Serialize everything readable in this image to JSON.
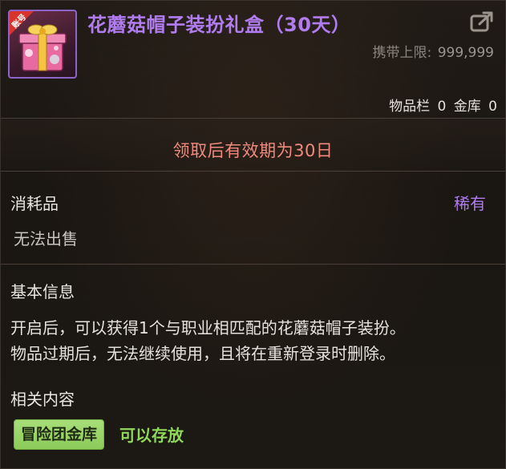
{
  "item": {
    "name": "花蘑菇帽子装扮礼盒（30天）",
    "icon": "gift-box-icon",
    "icon_badge": "账号",
    "carry_limit_label": "携带上限:",
    "carry_limit_value": "999,999",
    "inventory_label": "物品栏",
    "inventory_count": "0",
    "vault_label": "金库",
    "vault_count": "0"
  },
  "notice": "领取后有效期为30日",
  "category": "消耗品",
  "rarity": "稀有",
  "sell_status": "无法出售",
  "basic_info": {
    "title": "基本信息",
    "lines": [
      "开启后，可以获得1个与职业相匹配的花蘑菇帽子装扮。",
      "物品过期后，无法继续使用，且将在重新登录时删除。"
    ]
  },
  "related": {
    "title": "相关内容",
    "tag_label": "冒险团金库",
    "tag_status": "可以存放"
  },
  "colors": {
    "item_name": "#b07cf0",
    "rarity": "#b07cf0",
    "notice": "#f08a7e",
    "tag_bg": "#9bd46a",
    "tag_status": "#8fd85a"
  }
}
